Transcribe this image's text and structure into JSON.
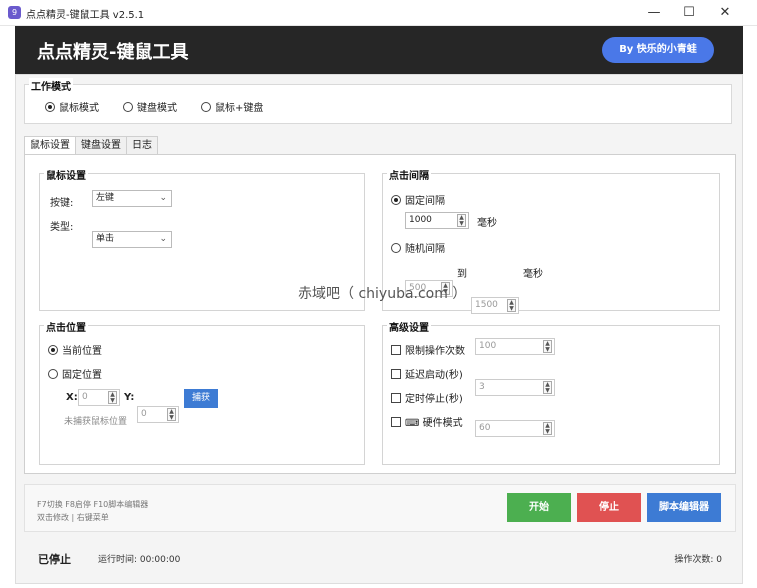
{
  "window": {
    "title": "点点精灵-键鼠工具 v2.5.1",
    "icon_glyph": "9",
    "min": "—",
    "max": "☐",
    "close": "✕"
  },
  "header": {
    "title": "点点精灵-键鼠工具",
    "badge": "By 快乐的小青蛙"
  },
  "work_mode": {
    "legend": "工作模式",
    "options": [
      "鼠标模式",
      "键盘模式",
      "鼠标+键盘"
    ],
    "selected": 0
  },
  "tabs": [
    "鼠标设置",
    "键盘设置",
    "日志"
  ],
  "mouse_settings": {
    "legend": "鼠标设置",
    "button_label": "按键:",
    "button_value": "左键",
    "type_label": "类型:",
    "type_value": "单击"
  },
  "click_interval": {
    "legend": "点击间隔",
    "fixed_label": "固定间隔",
    "fixed_value": "1000",
    "fixed_unit": "毫秒",
    "random_label": "随机间隔",
    "random_from": "500",
    "random_to_label": "到",
    "random_to": "1500",
    "random_unit": "毫秒"
  },
  "watermark": "赤域吧（ chiyuba.com ）",
  "click_position": {
    "legend": "点击位置",
    "current_label": "当前位置",
    "fixed_label": "固定位置",
    "x_label": "X:",
    "x_value": "0",
    "y_label": "Y:",
    "y_value": "0",
    "capture_button": "捕获",
    "capture_hint": "未捕获鼠标位置"
  },
  "advanced": {
    "legend": "高级设置",
    "limit_label": "限制操作次数",
    "limit_value": "100",
    "delay_label": "延迟启动(秒)",
    "delay_value": "3",
    "timer_label": "定时停止(秒)",
    "timer_value": "60",
    "hardware_label": "⌨ 硬件模式"
  },
  "hotkeys": {
    "line1": "F7切换 F8启停 F10脚本编辑器",
    "line2": "双击修改 | 右键菜单"
  },
  "buttons": {
    "start": "开始",
    "stop": "停止",
    "editor": "脚本编辑器"
  },
  "status": {
    "state": "已停止",
    "runtime": "运行时间: 00:00:00",
    "ops": "操作次数: 0"
  },
  "colors": {
    "header_bg": "#262626",
    "badge": "#4a78e8",
    "start": "#4caf50",
    "stop": "#e05252",
    "editor": "#3d7bd4",
    "capture": "#3d7bd4"
  }
}
